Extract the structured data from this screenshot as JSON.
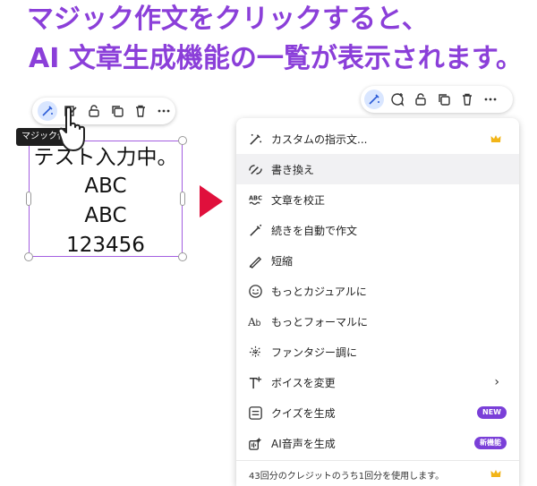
{
  "headline": {
    "line1": "マジック作文をクリックすると、",
    "line2": "AI 文章生成機能の一覧が表示されます。"
  },
  "tooltip": "マジック作文",
  "textbox": {
    "lines": [
      "テスト入力中。",
      "ABC",
      "ABC",
      "123456"
    ]
  },
  "toolbar_icons": [
    "magic-write-icon",
    "magic-edit-icon",
    "lock-icon",
    "duplicate-icon",
    "trash-icon",
    "more-icon"
  ],
  "menu": {
    "items": [
      {
        "icon": "custom-instruction-icon",
        "label": "カスタムの指示文..."
      },
      {
        "icon": "rewrite-icon",
        "label": "書き換え"
      },
      {
        "icon": "proofread-icon",
        "label": "文章を校正"
      },
      {
        "icon": "continue-writing-icon",
        "label": "続きを自動で作文"
      },
      {
        "icon": "shorten-icon",
        "label": "短縮"
      },
      {
        "icon": "smile-icon",
        "label": "もっとカジュアルに"
      },
      {
        "icon": "formal-icon",
        "label": "もっとフォーマルに"
      },
      {
        "icon": "sparkle-icon",
        "label": "ファンタジー調に"
      },
      {
        "icon": "voice-icon",
        "label": "ボイスを変更"
      },
      {
        "icon": "quiz-icon",
        "label": "クイズを生成",
        "badge": "NEW"
      },
      {
        "icon": "ai-voice-icon",
        "label": "AI音声を生成",
        "badge": "新機能"
      }
    ],
    "footer": "43回分のクレジットのうち1回分を使用します。"
  },
  "colors": {
    "headline": "#8b3fd9",
    "arrow": "#e0103c",
    "badge": "#7a3fd8",
    "crown": "#f2b518",
    "selection": "#a35ee0"
  }
}
